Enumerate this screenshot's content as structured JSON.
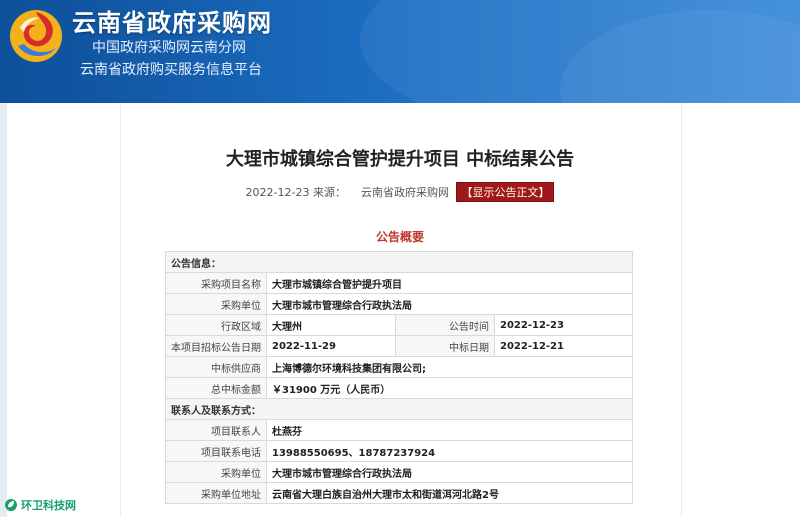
{
  "header": {
    "site_title": "云南省政府采购网",
    "subtitle_1": "中国政府采购网云南分网",
    "subtitle_2": "云南省政府购买服务信息平台"
  },
  "notice": {
    "title": "大理市城镇综合管护提升项目 中标结果公告",
    "date": "2022-12-23",
    "source_label": "来源：",
    "source_name": "云南省政府采购网",
    "show_full_text": "【显示公告正文】"
  },
  "summary_heading": "公告概要",
  "section_notice_info": "公告信息：",
  "section_contact": "联系人及联系方式：",
  "fields": {
    "project_name": {
      "label": "采购项目名称",
      "value": "大理市城镇综合管护提升项目"
    },
    "purchaser": {
      "label": "采购单位",
      "value": "大理市城市管理综合行政执法局"
    },
    "region": {
      "label": "行政区域",
      "value": "大理州"
    },
    "publish_time": {
      "label": "公告时间",
      "value": "2022-12-23"
    },
    "tender_notice_date": {
      "label": "本项目招标公告日期",
      "value": "2022-11-29"
    },
    "award_date": {
      "label": "中标日期",
      "value": "2022-12-21"
    },
    "supplier": {
      "label": "中标供应商",
      "value": "上海博德尔环境科技集团有限公司;"
    },
    "total_amount": {
      "label": "总中标金额",
      "value": "￥31900 万元（人民币）"
    },
    "contact_person": {
      "label": "项目联系人",
      "value": "杜燕芬"
    },
    "contact_phone": {
      "label": "项目联系电话",
      "value": "13988550695、18787237924"
    },
    "contact_unit": {
      "label": "采购单位",
      "value": "大理市城市管理综合行政执法局"
    },
    "unit_address": {
      "label": "采购单位地址",
      "value": "云南省大理白族自治州大理市太和街道洱河北路2号"
    }
  },
  "watermark": {
    "text": "环卫科技网"
  },
  "colors": {
    "header_blue": "#1b6cc0",
    "accent_red": "#a01818",
    "watermark_green": "#18a06c"
  }
}
